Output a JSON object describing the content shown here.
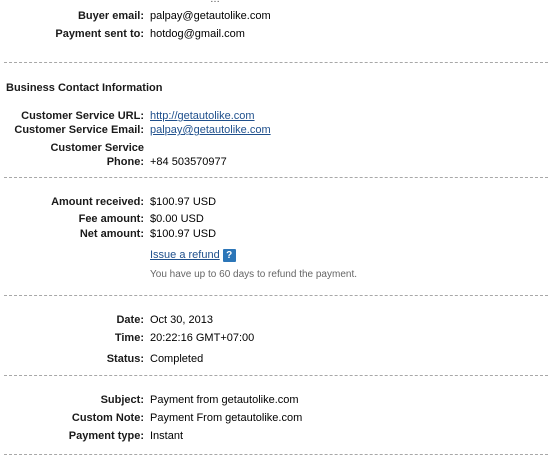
{
  "top_cut": "…",
  "buyer": {
    "email_label": "Buyer email:",
    "email_value": "palpay@getautolike.com",
    "sent_to_label": "Payment sent to:",
    "sent_to_value": "hotdog@gmail.com"
  },
  "business": {
    "title": "Business Contact Information",
    "url_label": "Customer Service URL:",
    "url_value": "http://getautolike.com",
    "email_label": "Customer Service Email:",
    "email_value": "palpay@getautolike.com",
    "phone_label_line1": "Customer Service",
    "phone_label_line2": "Phone:",
    "phone_value": "+84 503570977"
  },
  "amounts": {
    "received_label": "Amount received:",
    "received_value": "$100.97 USD",
    "fee_label": "Fee amount:",
    "fee_value": "$0.00 USD",
    "net_label": "Net amount:",
    "net_value": "$100.97 USD",
    "refund_link": "Issue a refund",
    "help_icon_glyph": "?",
    "refund_note": "You have up to 60 days to refund the payment."
  },
  "datetime": {
    "date_label": "Date:",
    "date_value": "Oct 30, 2013",
    "time_label": "Time:",
    "time_value": "20:22:16 GMT+07:00",
    "status_label": "Status:",
    "status_value": "Completed"
  },
  "details": {
    "subject_label": "Subject:",
    "subject_value": "Payment from getautolike.com",
    "note_label": "Custom Note:",
    "note_value": "Payment From getautolike.com",
    "type_label": "Payment type:",
    "type_value": "Instant"
  },
  "colors": {
    "link": "#1e4f8c",
    "help_icon_bg": "#2c76b8",
    "separator": "#a8a8a8"
  }
}
